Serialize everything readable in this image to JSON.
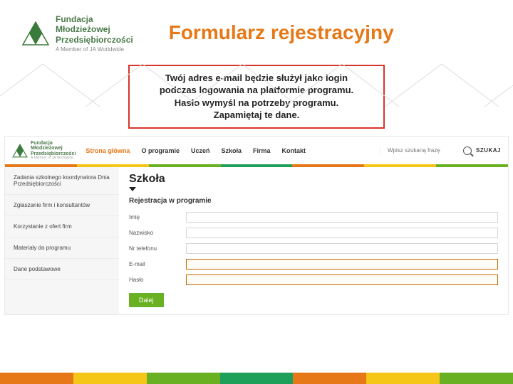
{
  "header": {
    "logo_line1": "Fundacja",
    "logo_line2": "Młodzieżowej",
    "logo_line3": "Przedsiębiorczości",
    "logo_sub": "A Member of JA Worldwide",
    "title": "Formularz rejestracyjny"
  },
  "info": {
    "line1": "Twój adres e-mail będzie służył jako login",
    "line2": "podczas logowania na platformie programu.",
    "line3": "Hasło wymyśl na potrzeby programu.",
    "line4": "Zapamiętaj te dane."
  },
  "app": {
    "logo_line1": "Fundacja",
    "logo_line2": "Młodzieżowej",
    "logo_line3": "Przedsiębiorczości",
    "logo_sub": "A Member of JA Worldwide",
    "nav": {
      "home": "Strona główna",
      "about": "O programie",
      "student": "Uczeń",
      "school": "Szkoła",
      "company": "Firma",
      "contact": "Kontakt"
    },
    "search_placeholder": "Wpisz szukaną frazę",
    "search_btn": "SZUKAJ",
    "sidebar": {
      "item0": "Zadania szkolnego koordynatora Dnia Przedsiębiorczości",
      "item1": "Zgłaszanie firm i konsultantów",
      "item2": "Korzystanie z ofert firm",
      "item3": "Materiały do programu",
      "item4": "Dane podstawowe"
    },
    "main": {
      "title": "Szkoła",
      "subtitle": "Rejestracja w programie",
      "labels": {
        "imie": "Imię",
        "nazwisko": "Nazwisko",
        "telefon": "Nr telefonu",
        "email": "E-mail",
        "haslo": "Hasło"
      },
      "values": {
        "imie": "",
        "nazwisko": "",
        "telefon": "",
        "email": "",
        "haslo": ""
      },
      "dalej": "Dalej"
    }
  }
}
